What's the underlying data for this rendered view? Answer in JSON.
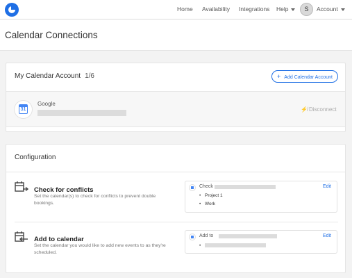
{
  "nav": {
    "links": [
      "Home",
      "Availability",
      "Integrations"
    ],
    "help": "Help",
    "avatar_initial": "S",
    "account": "Account"
  },
  "page": {
    "title": "Calendar Connections"
  },
  "calendar_account": {
    "title": "My Calendar Account",
    "count": "1/6",
    "add_button": "Add Calendar Account",
    "provider": "Google",
    "calendar_icon_day": "31",
    "disconnect": "Disconnect"
  },
  "configuration": {
    "title": "Configuration",
    "conflicts": {
      "title": "Check for conflicts",
      "description": "Set the calendar(s) to check for conflicts to prevent double bookings.",
      "summary_label": "Check",
      "edit": "Edit",
      "items": [
        "Project 1",
        "Work"
      ]
    },
    "add": {
      "title": "Add to calendar",
      "description": "Set the calendar you would like to add new events to as they're scheduled.",
      "summary_label": "Add to",
      "edit": "Edit"
    }
  },
  "colors": {
    "accent": "#1f6fe5",
    "google_blue": "#4285f4"
  }
}
